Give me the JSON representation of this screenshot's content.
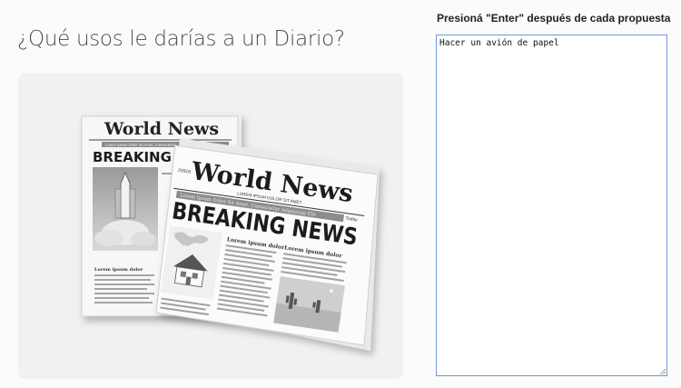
{
  "question": {
    "title": "¿Qué usos le darías a un Diario?"
  },
  "image": {
    "back_paper": {
      "masthead": "World News",
      "headline": "BREAKING",
      "subtitle": "Lorem Ipsum Dolor Sit Amet, Consectetur",
      "article_title": "Lorem ipsum dolor"
    },
    "front_paper": {
      "masthead": "World News",
      "tagline": "LOREM IPSUM DOLOR SIT AMET",
      "date": "23918",
      "day": "Today",
      "subtitle": "Lorem Ipsum Dolor Sit Amet, Consectetur Adipiscing Elit",
      "headline": "BREAKING NEWS",
      "article1_title": "Lorem ipsum dolor",
      "article2_title": "Lorem ipsum dolor"
    }
  },
  "answer": {
    "label": "Presioná \"Enter\" después de cada propuesta",
    "value": "Hacer un avión de papel"
  }
}
